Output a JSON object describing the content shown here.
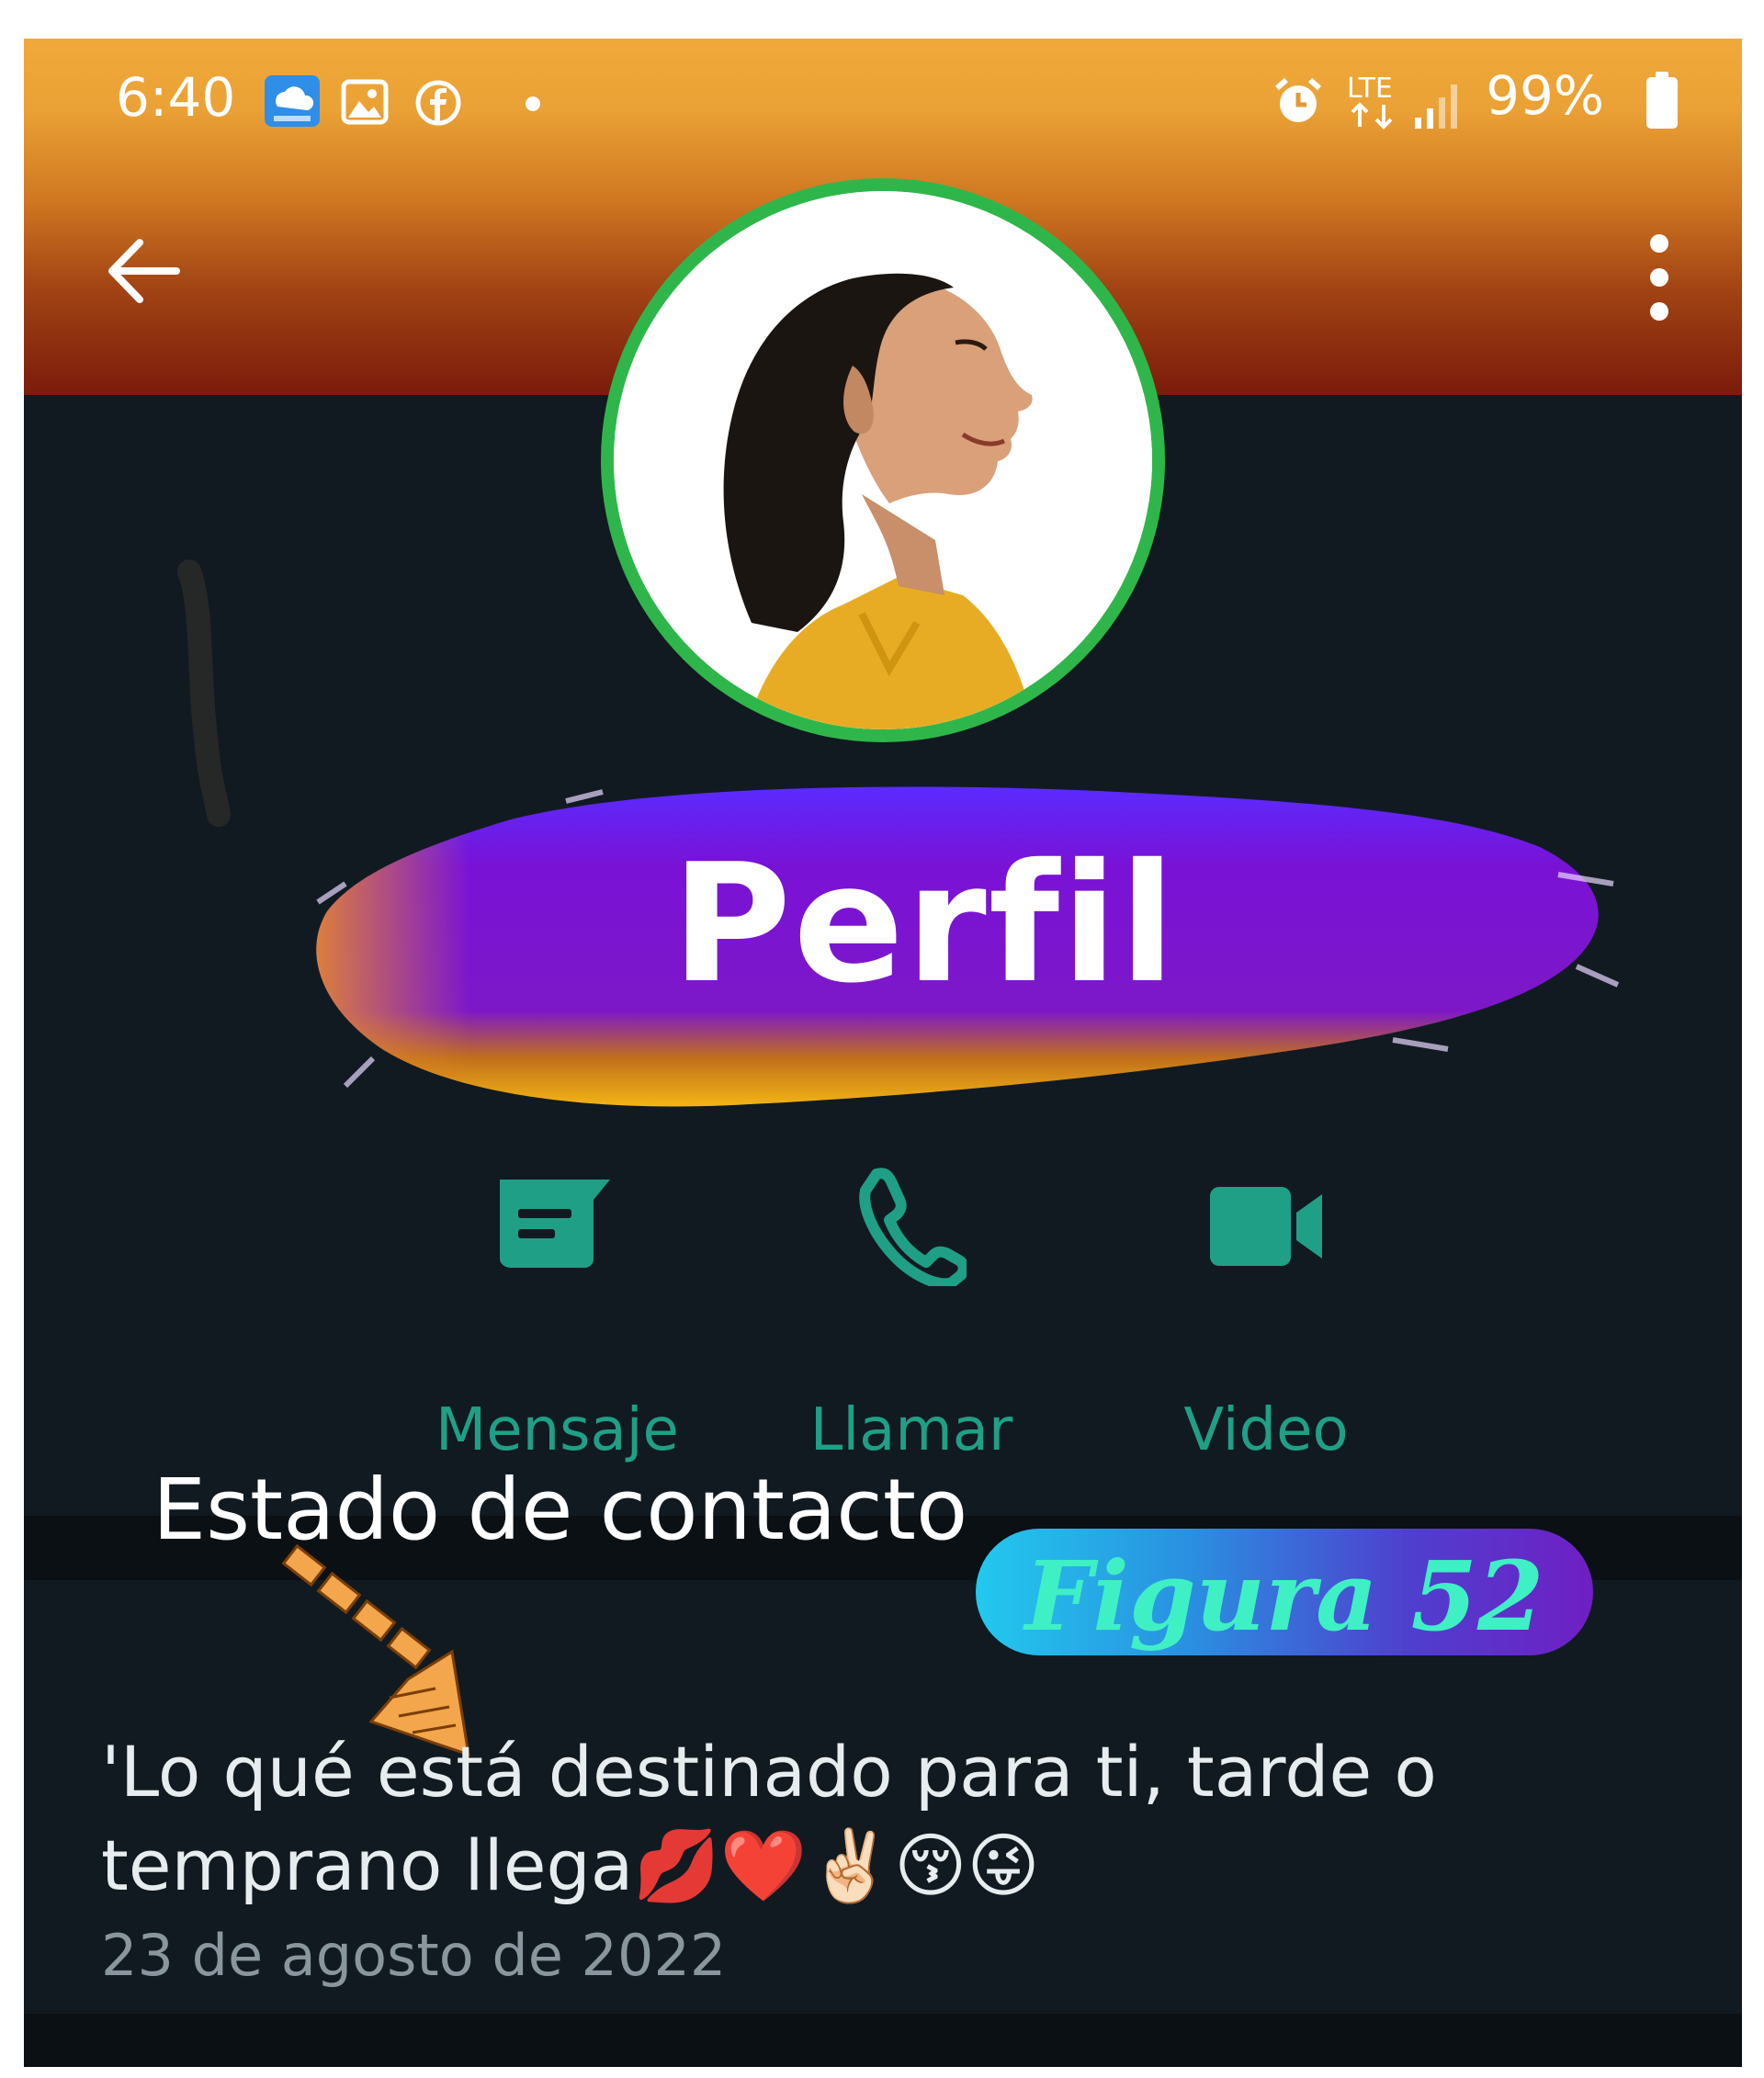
{
  "status_bar": {
    "time": "6:40",
    "network": "LTE",
    "battery": "99%",
    "icons": [
      "cloud-app-icon",
      "gallery-icon",
      "facebook-icon",
      "notification-dot-icon",
      "alarm-icon",
      "lte-icon",
      "signal-icon",
      "battery-icon"
    ]
  },
  "header": {
    "back_icon": "arrow-left-icon",
    "menu_icon": "more-vertical-icon"
  },
  "banner": {
    "title": "Perfil"
  },
  "actions": [
    {
      "label": "Mensaje",
      "icon": "message-icon"
    },
    {
      "label": "Llamar",
      "icon": "phone-icon"
    },
    {
      "label": "Video",
      "icon": "video-icon"
    }
  ],
  "annotation": {
    "heading": "Estado de contacto",
    "figure": "Figura 52"
  },
  "contact_status": {
    "message": "'Lo qué está destinado para ti, tarde o temprano llega💋❤️✌🏻😚😜",
    "date": "23 de agosto de 2022"
  },
  "colors": {
    "accent_green": "#1fa086",
    "background": "#111a21",
    "header_top": "#f0a93a",
    "header_bottom": "#7b1b0b",
    "brush_purple": "#7a12d6",
    "badge_start": "#22c9ee",
    "badge_end": "#6f1fc4"
  }
}
